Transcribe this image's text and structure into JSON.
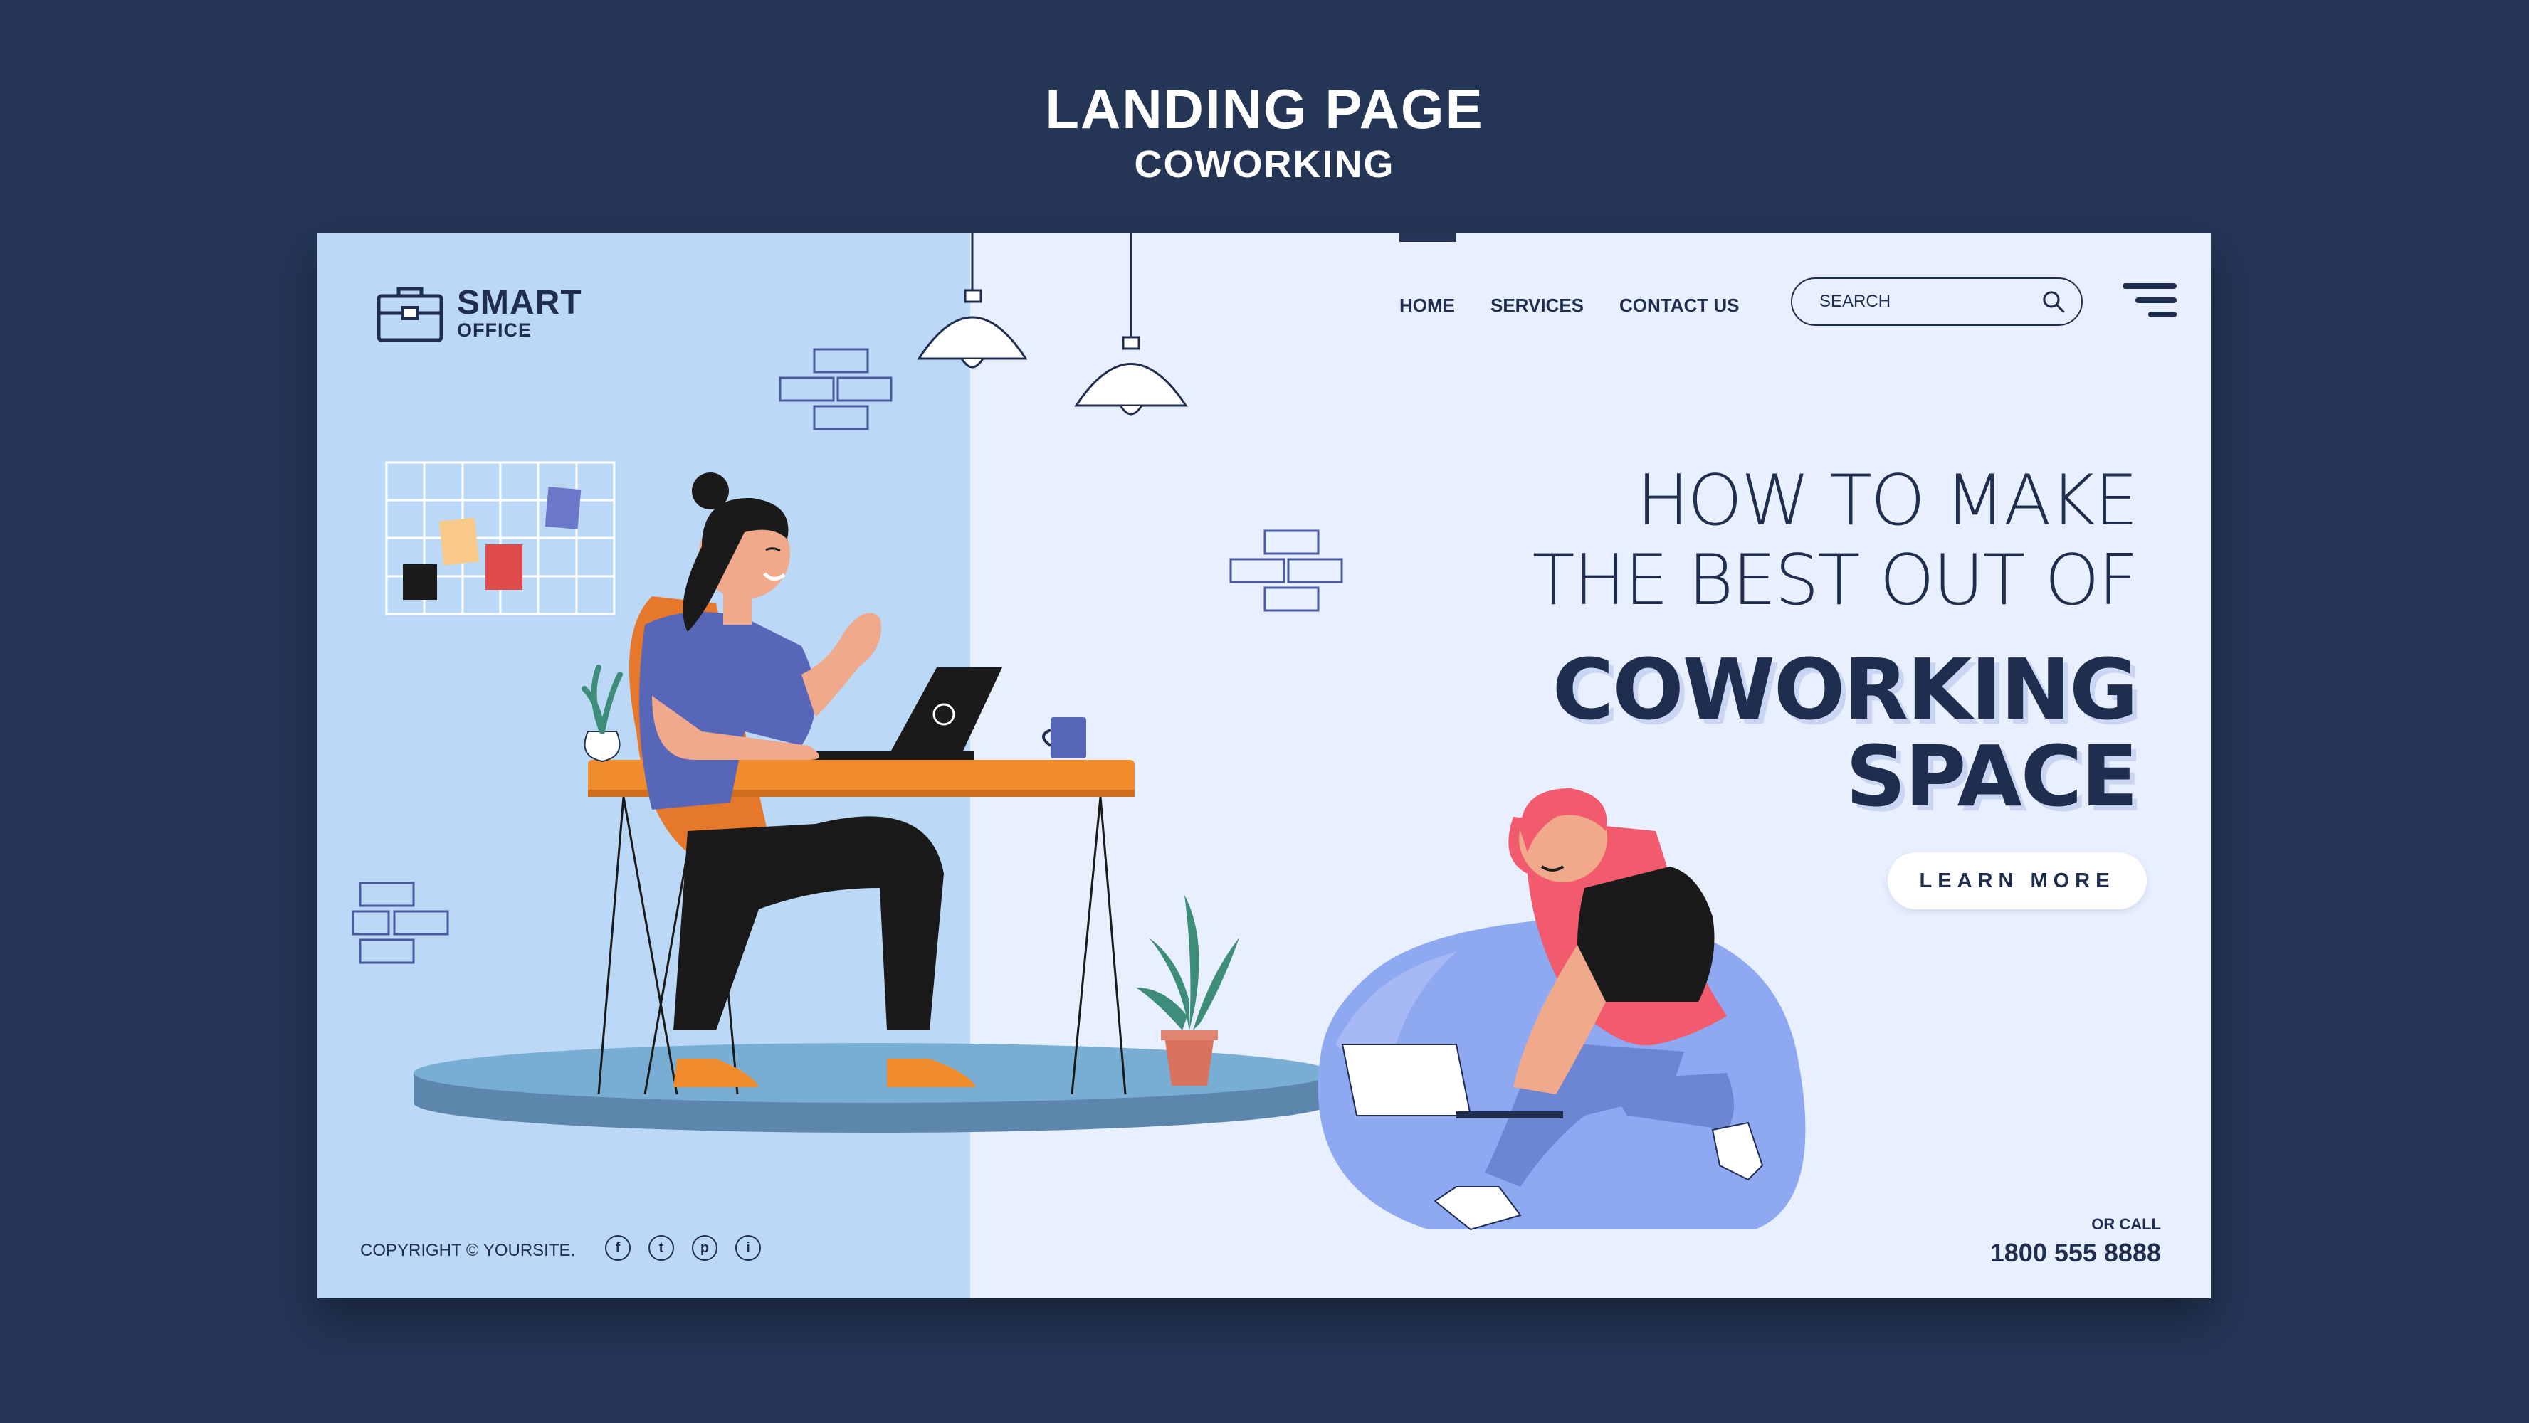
{
  "header": {
    "title": "LANDING PAGE",
    "subtitle": "COWORKING"
  },
  "brand": {
    "name": "SMART",
    "tagline": "OFFICE"
  },
  "nav": {
    "items": [
      "HOME",
      "SERVICES",
      "CONTACT US"
    ]
  },
  "search": {
    "placeholder": "SEARCH"
  },
  "hero": {
    "line1": "HOW TO MAKE",
    "line2": "THE BEST OUT OF",
    "line3": "COWORKING",
    "line4": "SPACE",
    "cta": "LEARN MORE"
  },
  "footer": {
    "copyright": "COPYRIGHT © YOURSITE.",
    "social": [
      "f",
      "t",
      "p",
      "i"
    ],
    "call_label": "OR CALL",
    "phone": "1800 555 8888"
  },
  "colors": {
    "background": "#243556",
    "card": "#e8efff",
    "left_panel": "#bcd8f7",
    "primary_text": "#1f2d4f",
    "accent_orange": "#e8892c",
    "accent_purple": "#6b78c9",
    "accent_pink": "#f25a6d"
  },
  "icons": [
    "briefcase-icon",
    "search-icon",
    "hamburger-menu-icon",
    "facebook-icon",
    "twitter-icon",
    "pinterest-icon",
    "instagram-icon"
  ]
}
